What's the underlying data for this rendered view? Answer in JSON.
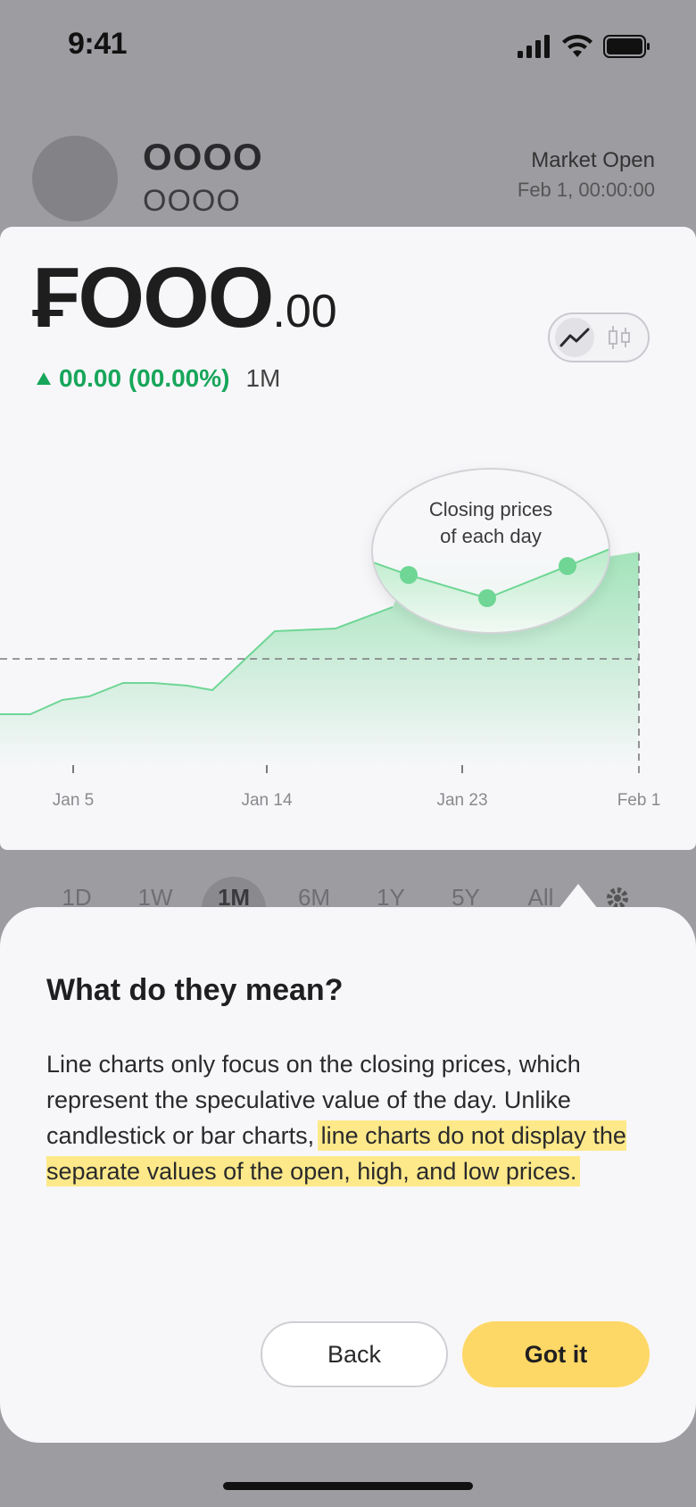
{
  "status_bar": {
    "time": "9:41",
    "icons": [
      "signal-icon",
      "wifi-icon",
      "battery-icon"
    ]
  },
  "header": {
    "ticker": "OOOO",
    "ticker_sub": "OOOO",
    "market_status": "Market Open",
    "market_time": "Feb 1, 00:00:00"
  },
  "price": {
    "currency_symbol": "₣",
    "whole": "OOO",
    "cents": ".00",
    "change": "00.00 (00.00%)",
    "period": "1M",
    "change_color": "#17a65a"
  },
  "chart_toggle": {
    "options": [
      "line-chart-icon",
      "candlestick-icon"
    ],
    "selected": "line-chart-icon"
  },
  "chart_data": {
    "type": "area",
    "x_ticks": [
      "Jan 5",
      "Jan 14",
      "Jan 23",
      "Feb 1"
    ],
    "series_color": "#6fd695",
    "baseline": "dashed",
    "callout": {
      "line1": "Closing prices",
      "line2": "of each day"
    }
  },
  "timeframes": {
    "items": [
      "1D",
      "1W",
      "1M",
      "6M",
      "1Y",
      "5Y",
      "All"
    ],
    "selected": "1M",
    "settings_icon": "gear-icon"
  },
  "sheet": {
    "title": "What do they mean?",
    "body_plain": "Line charts only focus on the closing prices, which represent the speculative value of the day. Unlike candlestick or bar charts, ",
    "body_highlight": "line charts do not display the separate values of the open, high, and low prices.",
    "highlight_color": "#fde98a",
    "back_label": "Back",
    "got_it_label": "Got it",
    "primary_color": "#fed866"
  }
}
